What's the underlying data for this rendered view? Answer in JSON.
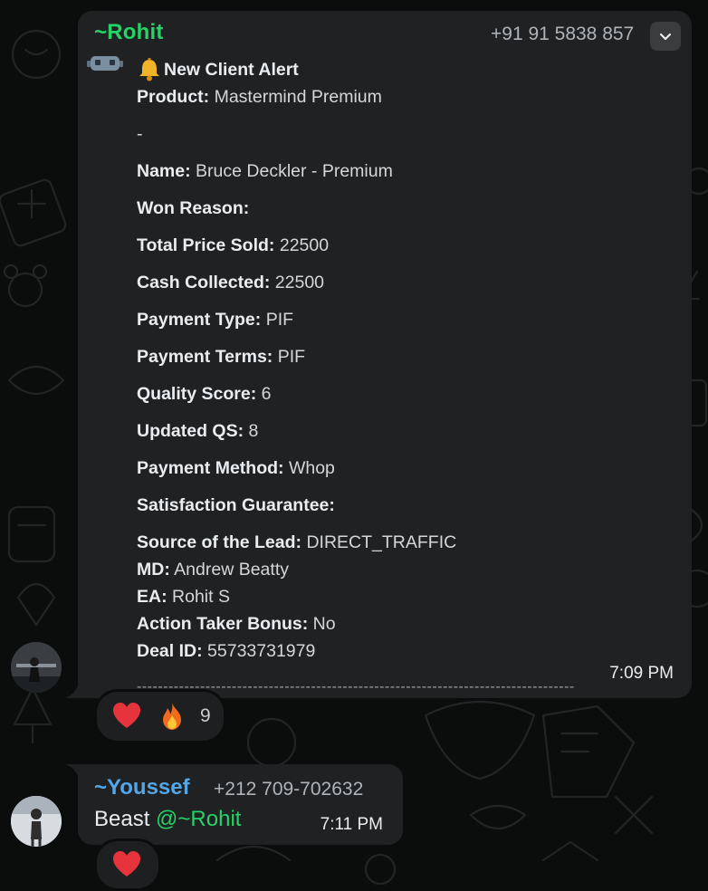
{
  "message_rohit": {
    "sender_name": "~Rohit",
    "sender_phone": "+91 91 5838 857",
    "time": "7:09 PM",
    "alert_title": "New Client Alert",
    "fields": [
      {
        "label": "Product:",
        "value": "Mastermind Premium"
      },
      {
        "label": "",
        "value": "-"
      },
      {
        "label": "Name:",
        "value": "Bruce Deckler - Premium"
      },
      {
        "label": "Won Reason:",
        "value": ""
      },
      {
        "label": "Total Price Sold:",
        "value": "22500"
      },
      {
        "label": "Cash Collected:",
        "value": "22500"
      },
      {
        "label": "Payment Type:",
        "value": "PIF"
      },
      {
        "label": "Payment Terms:",
        "value": "PIF"
      },
      {
        "label": "Quality Score:",
        "value": "6"
      },
      {
        "label": "Updated QS:",
        "value": "8"
      },
      {
        "label": "Payment Method:",
        "value": "Whop"
      },
      {
        "label": "Satisfaction Guarantee:",
        "value": ""
      },
      {
        "label": "Source of the Lead:",
        "value": "DIRECT_TRAFFIC"
      },
      {
        "label": "MD:",
        "value": "Andrew Beatty"
      },
      {
        "label": "EA:",
        "value": "Rohit S"
      },
      {
        "label": "Action Taker Bonus:",
        "value": "No"
      },
      {
        "label": "Deal ID:",
        "value": "55733731979"
      }
    ],
    "divider": "-----------------------------------------------------------------------------------",
    "reactions": {
      "emojis": [
        "heart",
        "fire"
      ],
      "count": "9"
    }
  },
  "message_youssef": {
    "sender_name": "~Youssef",
    "sender_phone": "+212 709-702632",
    "text_prefix": "Beast ",
    "mention": "@~Rohit",
    "time": "7:11 PM",
    "reactions": {
      "emojis": [
        "heart"
      ]
    }
  },
  "colors": {
    "background": "#0b0c0c",
    "bubble": "#202123",
    "rohit_name": "#25d366",
    "youssef_name": "#53a6e8",
    "mention": "#25d366"
  },
  "icons": [
    "robot-emoji-icon",
    "bell-icon",
    "chevron-down-icon",
    "heart-icon",
    "fire-icon"
  ]
}
